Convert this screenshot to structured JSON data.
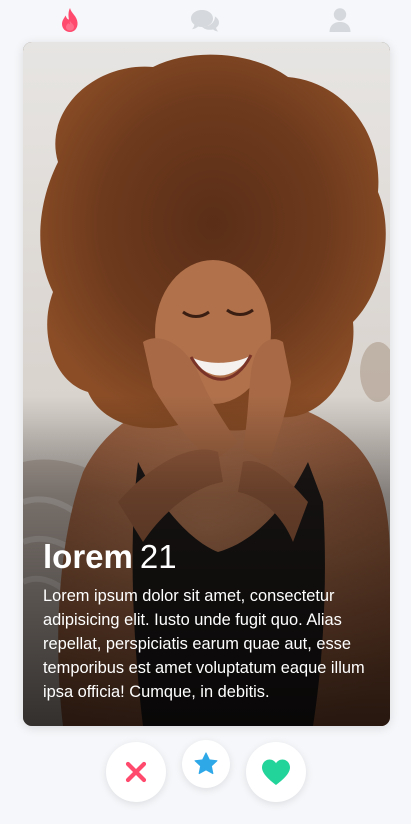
{
  "nav": {
    "items": [
      {
        "id": "discover",
        "icon": "flame-icon",
        "active": true
      },
      {
        "id": "messages",
        "icon": "chat-bubbles-icon",
        "active": false
      },
      {
        "id": "profile",
        "icon": "user-icon",
        "active": false
      }
    ],
    "active_color": "#ff4a6e",
    "inactive_color": "#d5d8dc"
  },
  "profile": {
    "name": "lorem",
    "age": "21",
    "bio": "Lorem ipsum dolor sit amet, consectetur adipisicing elit. Iusto unde fugit quo. Alias repellat, perspiciatis earum quae aut, esse temporibus est amet voluptatum eaque illum ipsa officia! Cumque, in debitis."
  },
  "actions": {
    "nope": {
      "icon": "close-icon",
      "color": "#ff4a6e"
    },
    "super_like": {
      "icon": "star-icon",
      "color": "#2fa8e8"
    },
    "like": {
      "icon": "heart-icon",
      "color": "#22d39a"
    }
  }
}
